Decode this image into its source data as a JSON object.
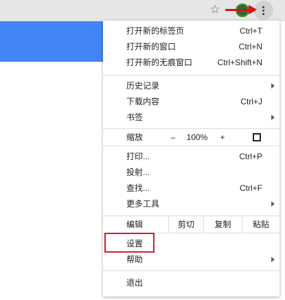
{
  "toolbar": {
    "bookmark_icon": "star-outline-icon",
    "avatar_icon": "profile-avatar-icon",
    "menu_icon": "three-dots-vertical-icon",
    "annotation_color": "#e01010",
    "highlight_color": "#cc1f2b",
    "page_accent": "#4285f4"
  },
  "menu": {
    "new_tab": {
      "label": "打开新的标签页",
      "shortcut": "Ctrl+T"
    },
    "new_window": {
      "label": "打开新的窗口",
      "shortcut": "Ctrl+N"
    },
    "new_incognito": {
      "label": "打开新的无痕窗口",
      "shortcut": "Ctrl+Shift+N"
    },
    "history": {
      "label": "历史记录"
    },
    "downloads": {
      "label": "下载内容",
      "shortcut": "Ctrl+J"
    },
    "bookmarks": {
      "label": "书签"
    },
    "zoom": {
      "label": "缩放",
      "minus": "–",
      "value": "100%",
      "plus": "+"
    },
    "print": {
      "label": "打印...",
      "shortcut": "Ctrl+P"
    },
    "cast": {
      "label": "投射..."
    },
    "find": {
      "label": "查找...",
      "shortcut": "Ctrl+F"
    },
    "more_tools": {
      "label": "更多工具"
    },
    "edit": {
      "label": "编辑",
      "cut": "剪切",
      "copy": "复制",
      "paste": "粘贴"
    },
    "settings": {
      "label": "设置"
    },
    "help": {
      "label": "帮助"
    },
    "exit": {
      "label": "退出"
    }
  }
}
